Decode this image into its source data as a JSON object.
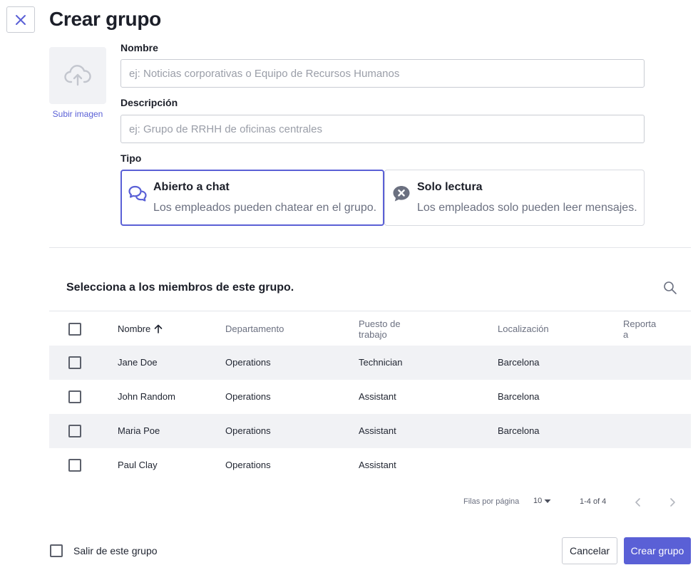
{
  "header": {
    "title": "Crear grupo",
    "close_icon": "close-icon"
  },
  "image_upload": {
    "icon": "cloud-upload-icon",
    "link_label": "Subir imagen"
  },
  "form": {
    "name_label": "Nombre",
    "name_placeholder": "ej: Noticias corporativas o Equipo de Recursos Humanos",
    "name_value": "",
    "description_label": "Descripción",
    "description_placeholder": "ej: Grupo de RRHH de oficinas centrales",
    "description_value": "",
    "type_label": "Tipo",
    "types": [
      {
        "title": "Abierto a chat",
        "description": "Los empleados pueden chatear en el grupo.",
        "icon": "chat-bubbles-icon",
        "selected": true
      },
      {
        "title": "Solo lectura",
        "description": "Los empleados solo pueden leer mensajes.",
        "icon": "no-chat-icon",
        "selected": false
      }
    ]
  },
  "members": {
    "title": "Selecciona a los miembros de este grupo.",
    "search_icon": "search-icon",
    "columns": [
      "Nombre",
      "Departamento",
      "Puesto de trabajo",
      "Localización",
      "Reporta a"
    ],
    "column_lines": {
      "job_1": "Puesto de",
      "job_2": "trabajo",
      "reports_1": "Reporta",
      "reports_2": "a"
    },
    "sort_icon": "arrow-up-icon",
    "rows": [
      {
        "name": "Jane Doe",
        "department": "Operations",
        "job": "Technician",
        "location": "Barcelona",
        "reports_to": ""
      },
      {
        "name": "John Random",
        "department": "Operations",
        "job": "Assistant",
        "location": "Barcelona",
        "reports_to": ""
      },
      {
        "name": "Maria Poe",
        "department": "Operations",
        "job": "Assistant",
        "location": "Barcelona",
        "reports_to": ""
      },
      {
        "name": "Paul Clay",
        "department": "Operations",
        "job": "Assistant",
        "location": "",
        "reports_to": ""
      }
    ]
  },
  "pagination": {
    "rows_per_page_label": "Filas por página",
    "rows_per_page_value": "10",
    "range": "1-4 of 4"
  },
  "footer": {
    "leave_label": "Salir de este grupo",
    "leave_checked": false,
    "cancel_label": "Cancelar",
    "create_label": "Crear grupo"
  },
  "colors": {
    "accent": "#5a60d6",
    "text": "#1c1f29",
    "muted": "#6b7080",
    "stripe": "#f1f2f5",
    "border": "#c9ccd3"
  }
}
